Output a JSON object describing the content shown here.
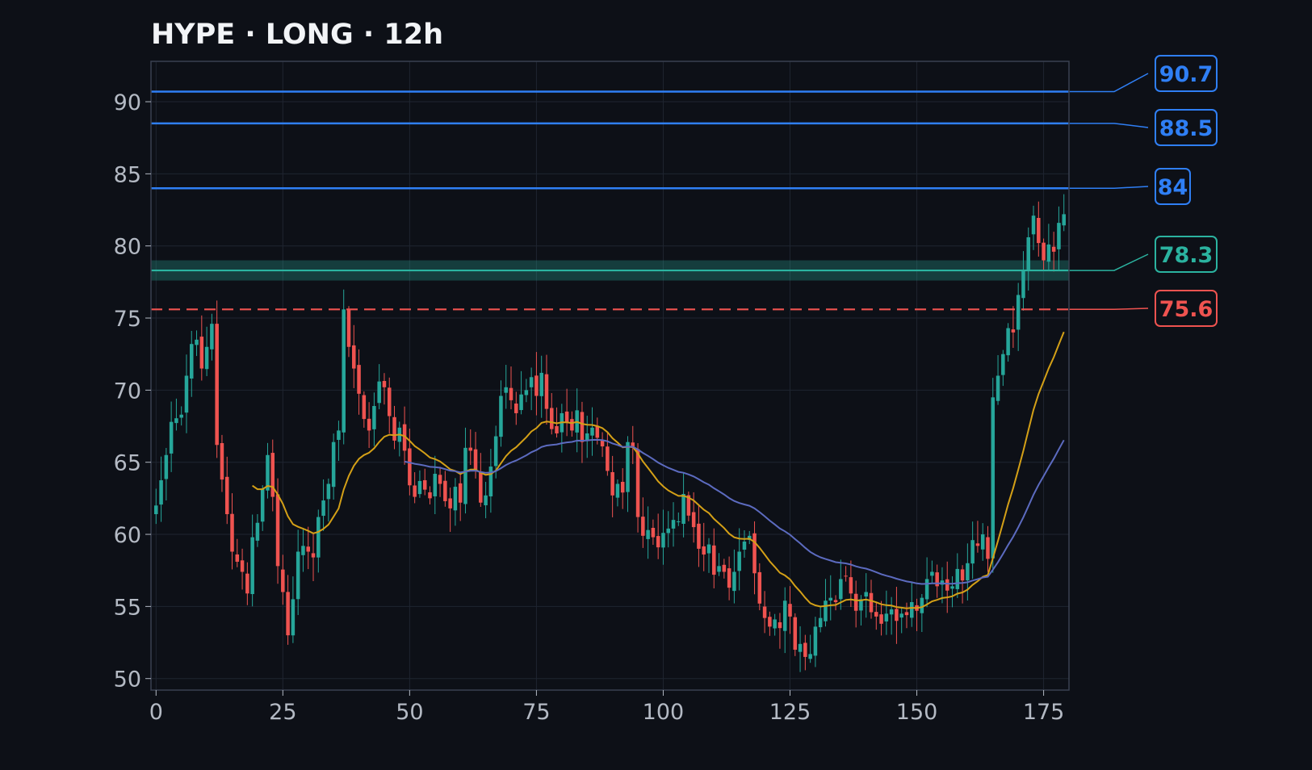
{
  "chart_data": {
    "type": "candlestick",
    "title": "HYPE · LONG · 12h",
    "xlabel": "",
    "ylabel": "",
    "xlim": [
      -1,
      180
    ],
    "ylim": [
      49.2,
      92.8
    ],
    "x_ticks": [
      0,
      25,
      50,
      75,
      100,
      125,
      150,
      175
    ],
    "y_ticks": [
      50,
      55,
      60,
      65,
      70,
      75,
      80,
      85,
      90
    ],
    "grid": true,
    "legend": "none",
    "colors": {
      "background": "#0d1017",
      "frame": "#3a4150",
      "grid": "#1f2530",
      "tick_text": "#b4bac4",
      "title_text": "#f2f4f7",
      "up_candle": "#26a69a",
      "down_candle": "#ef5350",
      "ema_fast": "#d4a017",
      "ema_slow": "#5c6bc0",
      "target": "#2f7ff5",
      "entry": "#2bb3a0",
      "stop": "#ef5350"
    },
    "close_anchors": [
      [
        0,
        62.0
      ],
      [
        2,
        65.5
      ],
      [
        3,
        67.8
      ],
      [
        5,
        68.3
      ],
      [
        6,
        71.0
      ],
      [
        7,
        73.2
      ],
      [
        8,
        73.5
      ],
      [
        9,
        71.5
      ],
      [
        10,
        73.0
      ],
      [
        11,
        74.6
      ],
      [
        12,
        66.2
      ],
      [
        14,
        61.4
      ],
      [
        15,
        58.8
      ],
      [
        17,
        57.4
      ],
      [
        18,
        55.9
      ],
      [
        19,
        59.8
      ],
      [
        20,
        60.8
      ],
      [
        22,
        65.5
      ],
      [
        23,
        62.6
      ],
      [
        24,
        57.8
      ],
      [
        25,
        56.0
      ],
      [
        26,
        53.0
      ],
      [
        27,
        55.5
      ],
      [
        28,
        58.8
      ],
      [
        29,
        59.2
      ],
      [
        31,
        58.4
      ],
      [
        32,
        61.2
      ],
      [
        34,
        63.5
      ],
      [
        35,
        66.4
      ],
      [
        36,
        67.2
      ],
      [
        37,
        75.6
      ],
      [
        38,
        73.0
      ],
      [
        39,
        71.5
      ],
      [
        41,
        68.0
      ],
      [
        42,
        67.2
      ],
      [
        44,
        70.6
      ],
      [
        45,
        70.2
      ],
      [
        46,
        68.2
      ],
      [
        47,
        66.5
      ],
      [
        48,
        67.4
      ],
      [
        49,
        65.8
      ],
      [
        50,
        63.4
      ],
      [
        51,
        62.6
      ],
      [
        52,
        63.7
      ],
      [
        54,
        62.5
      ],
      [
        55,
        64.2
      ],
      [
        56,
        63.5
      ],
      [
        57,
        62.3
      ],
      [
        58,
        61.8
      ],
      [
        59,
        63.3
      ],
      [
        60,
        62.2
      ],
      [
        61,
        66.0
      ],
      [
        62,
        65.8
      ],
      [
        63,
        64.5
      ],
      [
        64,
        62.2
      ],
      [
        65,
        62.7
      ],
      [
        66,
        64.7
      ],
      [
        67,
        66.8
      ],
      [
        68,
        69.6
      ],
      [
        69,
        70.2
      ],
      [
        70,
        69.3
      ],
      [
        71,
        68.4
      ],
      [
        72,
        69.7
      ],
      [
        73,
        70.0
      ],
      [
        74,
        70.9
      ],
      [
        75,
        69.6
      ],
      [
        76,
        71.2
      ],
      [
        77,
        68.7
      ],
      [
        78,
        67.3
      ],
      [
        79,
        67.0
      ],
      [
        80,
        68.4
      ],
      [
        81,
        67.8
      ],
      [
        82,
        67.2
      ],
      [
        83,
        68.6
      ],
      [
        84,
        66.4
      ],
      [
        85,
        67.0
      ],
      [
        86,
        67.4
      ],
      [
        87,
        66.7
      ],
      [
        88,
        66.1
      ],
      [
        89,
        64.4
      ],
      [
        90,
        62.7
      ],
      [
        91,
        63.5
      ],
      [
        92,
        62.9
      ],
      [
        93,
        66.4
      ],
      [
        94,
        66.0
      ],
      [
        95,
        61.2
      ],
      [
        96,
        59.9
      ],
      [
        97,
        60.3
      ],
      [
        98,
        59.8
      ],
      [
        99,
        59.1
      ],
      [
        100,
        60.1
      ],
      [
        101,
        60.4
      ],
      [
        102,
        61.0
      ],
      [
        103,
        60.9
      ],
      [
        104,
        62.8
      ],
      [
        105,
        61.3
      ],
      [
        106,
        60.5
      ],
      [
        107,
        59.0
      ],
      [
        108,
        58.6
      ],
      [
        109,
        59.3
      ],
      [
        110,
        57.2
      ],
      [
        111,
        57.8
      ],
      [
        112,
        57.4
      ],
      [
        113,
        56.3
      ],
      [
        114,
        57.4
      ],
      [
        115,
        58.8
      ],
      [
        116,
        59.5
      ],
      [
        117,
        59.9
      ],
      [
        118,
        57.3
      ],
      [
        119,
        55.2
      ],
      [
        120,
        54.2
      ],
      [
        121,
        53.6
      ],
      [
        122,
        54.1
      ],
      [
        123,
        53.5
      ],
      [
        124,
        55.4
      ],
      [
        125,
        54.3
      ],
      [
        126,
        52.0
      ],
      [
        127,
        52.4
      ],
      [
        128,
        51.5
      ],
      [
        129,
        51.7
      ],
      [
        130,
        53.6
      ],
      [
        131,
        54.2
      ],
      [
        132,
        55.4
      ],
      [
        133,
        55.6
      ],
      [
        134,
        55.3
      ],
      [
        135,
        56.9
      ],
      [
        136,
        57.1
      ],
      [
        137,
        55.9
      ],
      [
        138,
        54.7
      ],
      [
        139,
        55.5
      ],
      [
        140,
        56.0
      ],
      [
        141,
        54.6
      ],
      [
        142,
        54.3
      ],
      [
        143,
        53.8
      ],
      [
        144,
        54.5
      ],
      [
        145,
        54.8
      ],
      [
        146,
        54.0
      ],
      [
        147,
        54.5
      ],
      [
        148,
        54.4
      ],
      [
        149,
        55.3
      ],
      [
        150,
        54.7
      ],
      [
        151,
        55.6
      ],
      [
        152,
        56.9
      ],
      [
        153,
        57.4
      ],
      [
        154,
        56.4
      ],
      [
        155,
        56.8
      ],
      [
        156,
        56.1
      ],
      [
        157,
        56.4
      ],
      [
        158,
        57.6
      ],
      [
        159,
        56.8
      ],
      [
        160,
        58.0
      ],
      [
        161,
        59.6
      ],
      [
        162,
        59.2
      ],
      [
        163,
        60.0
      ],
      [
        164,
        58.3
      ],
      [
        165,
        69.5
      ],
      [
        166,
        71.0
      ],
      [
        167,
        72.5
      ],
      [
        168,
        74.3
      ],
      [
        169,
        74.0
      ],
      [
        170,
        76.6
      ],
      [
        171,
        78.3
      ],
      [
        172,
        80.6
      ],
      [
        173,
        82.1
      ],
      [
        174,
        80.2
      ],
      [
        175,
        79.0
      ],
      [
        176,
        80.1
      ],
      [
        177,
        79.6
      ],
      [
        178,
        81.6
      ],
      [
        179,
        82.2
      ]
    ],
    "levels": [
      {
        "label": "90.7",
        "value": 90.7,
        "kind": "target"
      },
      {
        "label": "88.5",
        "value": 88.5,
        "kind": "target"
      },
      {
        "label": "84",
        "value": 84.0,
        "kind": "target"
      },
      {
        "label": "78.3",
        "value": 78.3,
        "kind": "entry"
      },
      {
        "label": "75.6",
        "value": 75.6,
        "kind": "stop"
      }
    ],
    "entry_zone": [
      77.6,
      79.0
    ],
    "ema_fast_start": 19,
    "ema_slow_start": 49
  }
}
